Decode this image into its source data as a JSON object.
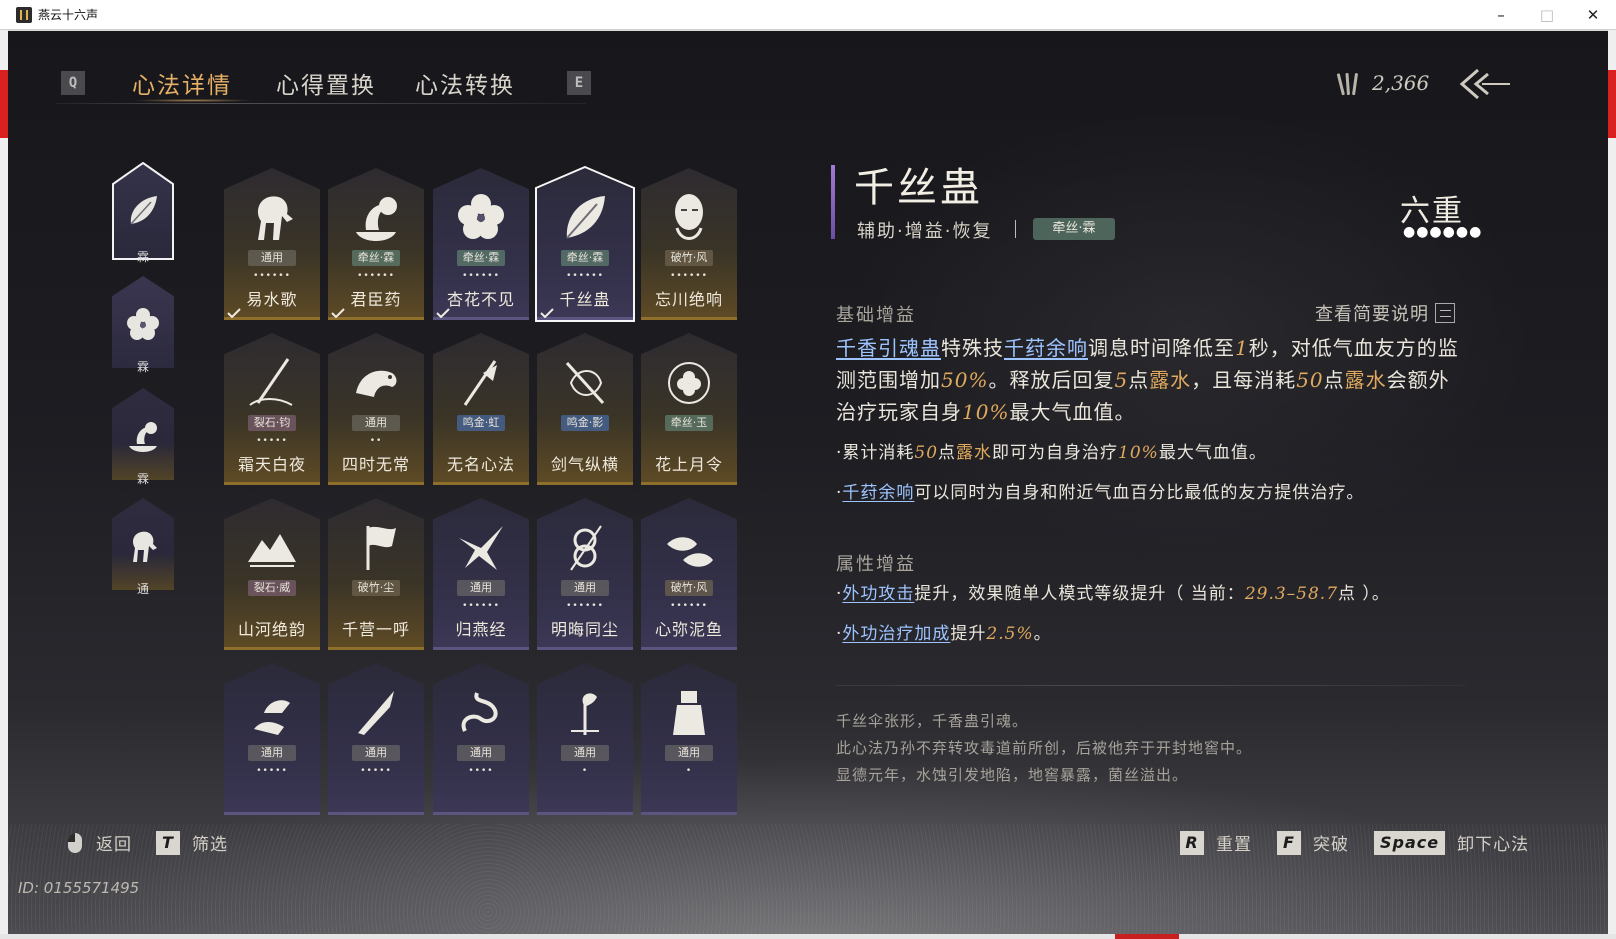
{
  "window": {
    "title": "燕云十六声",
    "minimize": "–",
    "maximize": "□",
    "close": "✕"
  },
  "tabs": {
    "left_key": "Q",
    "right_key": "E",
    "items": [
      "心法详情",
      "心得置换",
      "心法转换"
    ],
    "active_index": 0
  },
  "currency": {
    "value": "2,366",
    "icon": "feather-quills-icon"
  },
  "categories": [
    {
      "label": "霖",
      "icon": "leaf-icon",
      "selected": true
    },
    {
      "label": "霖",
      "icon": "flower-icon",
      "selected": false
    },
    {
      "label": "霖",
      "icon": "water-bowl-icon",
      "selected": false
    },
    {
      "label": "通",
      "icon": "horse-icon",
      "selected": false
    }
  ],
  "skills": [
    {
      "name": "易水歌",
      "tag": "通用",
      "dots": "••••••",
      "icon": "horse-icon",
      "color": "gold",
      "equipped": true
    },
    {
      "name": "君臣药",
      "tag": "牵丝·霖",
      "dots": "••••••",
      "icon": "water-bowl-icon",
      "color": "gold",
      "equipped": true
    },
    {
      "name": "杏花不见",
      "tag": "牵丝·霖",
      "dots": "••••••",
      "icon": "flower-icon",
      "color": "purple",
      "equipped": true
    },
    {
      "name": "千丝蛊",
      "tag": "牵丝·霖",
      "dots": "••••••",
      "icon": "leaf-icon",
      "color": "purple",
      "equipped": true,
      "selected": true
    },
    {
      "name": "忘川绝响",
      "tag": "破竹·风",
      "dots": "••••••",
      "icon": "mask-icon",
      "color": "gold",
      "equipped": false
    },
    {
      "name": "霜天白夜",
      "tag": "裂石·钧",
      "dots": "•••••",
      "icon": "spear-icon",
      "color": "gold",
      "equipped": false
    },
    {
      "name": "四时无常",
      "tag": "通用",
      "dots": "••",
      "icon": "beast-icon",
      "color": "gold",
      "equipped": false
    },
    {
      "name": "无名心法",
      "tag": "鸣金·虹",
      "dots": "",
      "icon": "sword-icon",
      "color": "gold",
      "equipped": false
    },
    {
      "name": "剑气纵横",
      "tag": "鸣金·影",
      "dots": "",
      "icon": "crossed-blade-icon",
      "color": "gold",
      "equipped": false
    },
    {
      "name": "花上月令",
      "tag": "牵丝·玉",
      "dots": "",
      "icon": "moon-flower-icon",
      "color": "gold",
      "equipped": false
    },
    {
      "name": "山河绝韵",
      "tag": "裂石·威",
      "dots": "",
      "icon": "mountain-icon",
      "color": "gold",
      "equipped": false
    },
    {
      "name": "千营一呼",
      "tag": "破竹·尘",
      "dots": "",
      "icon": "flag-icon",
      "color": "gold",
      "equipped": false
    },
    {
      "name": "归燕经",
      "tag": "通用",
      "dots": "••••••",
      "icon": "swallow-icon",
      "color": "purple",
      "equipped": false
    },
    {
      "name": "明晦同尘",
      "tag": "通用",
      "dots": "••••••",
      "icon": "knot-icon",
      "color": "purple",
      "equipped": false
    },
    {
      "name": "心弥泥鱼",
      "tag": "破竹·风",
      "dots": "••••••",
      "icon": "fish-icon",
      "color": "purple",
      "equipped": false
    },
    {
      "name": "",
      "tag": "通用",
      "dots": "•••••",
      "icon": "bird-hand-icon",
      "color": "purple",
      "equipped": false
    },
    {
      "name": "",
      "tag": "通用",
      "dots": "•••••",
      "icon": "blade-icon",
      "color": "purple",
      "equipped": false
    },
    {
      "name": "",
      "tag": "通用",
      "dots": "••••",
      "icon": "dragon-icon",
      "color": "purple",
      "equipped": false
    },
    {
      "name": "",
      "tag": "通用",
      "dots": "•",
      "icon": "plant-icon",
      "color": "purple",
      "equipped": false
    },
    {
      "name": "",
      "tag": "通用",
      "dots": "•",
      "icon": "statue-icon",
      "color": "purple",
      "equipped": false
    }
  ],
  "detail": {
    "title": "千丝蛊",
    "subtitle": "辅助·增益·恢复",
    "tag": "牵丝·霖",
    "rank": "六重",
    "rank_dots": "●●●●●●",
    "base_heading": "基础增益",
    "view_brief": "查看简要说明",
    "main_p1": "千香引魂蛊",
    "main_p2": "特殊技",
    "main_p3": "千荮余响",
    "main_p4": "调息时间降低至",
    "main_p5": "1",
    "main_p6": "秒，对低气血友方的监测范围增加",
    "main_p7": "50%",
    "main_p8": "。释放后回复",
    "main_p9": "5",
    "main_p10": "点",
    "main_p11": "露水",
    "main_p12": "，且每消耗",
    "main_p13": "50",
    "main_p14": "点",
    "main_p15": "露水",
    "main_p16": "会额外治疗玩家自身",
    "main_p17": "10%",
    "main_p18": "最大气血值。",
    "b1_p1": "·累计消耗",
    "b1_p2": "50",
    "b1_p3": "点",
    "b1_p4": "露水",
    "b1_p5": "即可为自身治疗",
    "b1_p6": "10%",
    "b1_p7": "最大气血值。",
    "b2_p1": "·",
    "b2_p2": "千荮余响",
    "b2_p3": "可以同时为自身和附近气血百分比最低的友方提供治疗。",
    "attr_heading": "属性增益",
    "a1_p1": "·",
    "a1_p2": "外功攻击",
    "a1_p3": "提升，效果随单人模式等级提升（ 当前：",
    "a1_p4": "29.3–58.7",
    "a1_p5": "点 ）。",
    "a2_p1": "·",
    "a2_p2": "外功治疗加成",
    "a2_p3": "提升",
    "a2_p4": "2.5%",
    "a2_p5": "。",
    "lore": [
      "千丝伞张形，千香蛊引魂。",
      "此心法乃孙不弃转攻毒道前所创，后被他弃于开封地窖中。",
      "显德元年，水蚀引发地陷，地窖暴露，菌丝溢出。"
    ]
  },
  "controls": {
    "back": "返回",
    "filter_key": "T",
    "filter": "筛选",
    "reset_key": "R",
    "reset": "重置",
    "break_key": "F",
    "break": "突破",
    "unload_key": "Space",
    "unload": "卸下心法"
  },
  "uid": "ID: 0155571495",
  "colors": {
    "gold_accent": "#e6b066",
    "link": "#9ec4ff",
    "highlight": "#e0a95d",
    "purple_bar": "#a27ad8"
  }
}
